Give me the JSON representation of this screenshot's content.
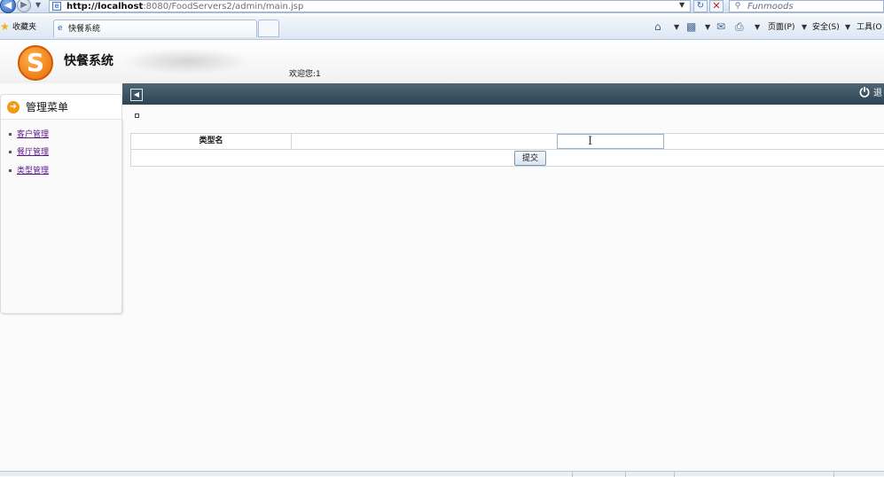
{
  "browser": {
    "url_host": "http://localhost",
    "url_rest": ":8080/FoodServers2/admin/main.jsp",
    "search_placeholder": "Funmoods",
    "favorites_label": "收藏夹",
    "tab_title": "快餐系统",
    "commands": {
      "page": "页面(P)",
      "safety": "安全(S)",
      "tools": "工具(O"
    }
  },
  "header": {
    "app_name": "快餐系统",
    "welcome": "欢迎您:1",
    "logout_label": "退"
  },
  "sidebar": {
    "title": "管理菜单",
    "items": [
      {
        "label": "客户管理"
      },
      {
        "label": "餐厅管理"
      },
      {
        "label": "类型管理"
      }
    ]
  },
  "form": {
    "field_label": "类型名",
    "field_value": "",
    "submit_label": "提交"
  },
  "colors": {
    "toolbar": "#3c5363",
    "accent_orange": "#f29a12",
    "link_visited": "#5a1a8a"
  }
}
